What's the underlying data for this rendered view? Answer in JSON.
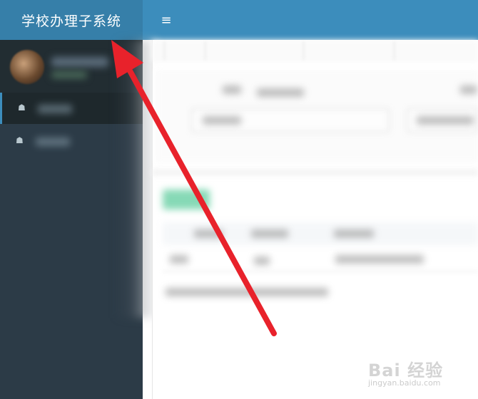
{
  "header": {
    "app_title": "学校办理子系统",
    "menu_toggle_icon": "≡"
  },
  "sidebar": {
    "items": [
      {
        "icon": "graduation-cap-icon",
        "glyph": "☗",
        "active": true
      },
      {
        "icon": "graduation-cap-icon",
        "glyph": "☗",
        "active": false
      }
    ]
  },
  "colors": {
    "topbar": "#3c8dbc",
    "brand_area": "#367fa9",
    "sidebar": "#2c3b47",
    "annotation_arrow": "#e8222b"
  },
  "watermark": {
    "main": "Bai 经验",
    "sub": "jingyan.baidu.com"
  }
}
